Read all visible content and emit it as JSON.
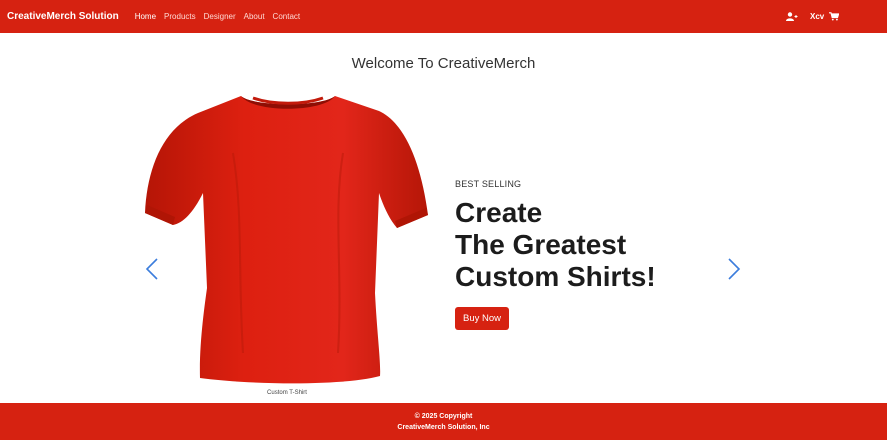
{
  "navbar": {
    "brand": "CreativeMerch Solution",
    "links": [
      {
        "label": "Home",
        "active": true
      },
      {
        "label": "Products"
      },
      {
        "label": "Designer"
      },
      {
        "label": "About"
      },
      {
        "label": "Contact"
      }
    ],
    "user_icon": "user-add-icon",
    "user_name": "Xcv",
    "cart_icon": "cart-icon"
  },
  "main": {
    "welcome": "Welcome To CreativeMerch",
    "carousel": {
      "image_caption": "Custom T-Shirt",
      "eyebrow": "BEST SELLING",
      "headline_lines": [
        "Create",
        "The Greatest",
        "Custom Shirts!"
      ],
      "cta_label": "Buy Now",
      "prev_icon": "chevron-left-icon",
      "next_icon": "chevron-right-icon"
    }
  },
  "footer": {
    "line1": "© 2025 Copyright",
    "line2": "CreativeMerch Solution, Inc"
  },
  "colors": {
    "brand_red": "#d62211",
    "shirt_red": "#dd2010",
    "arrow_blue": "#3b7ddd"
  }
}
